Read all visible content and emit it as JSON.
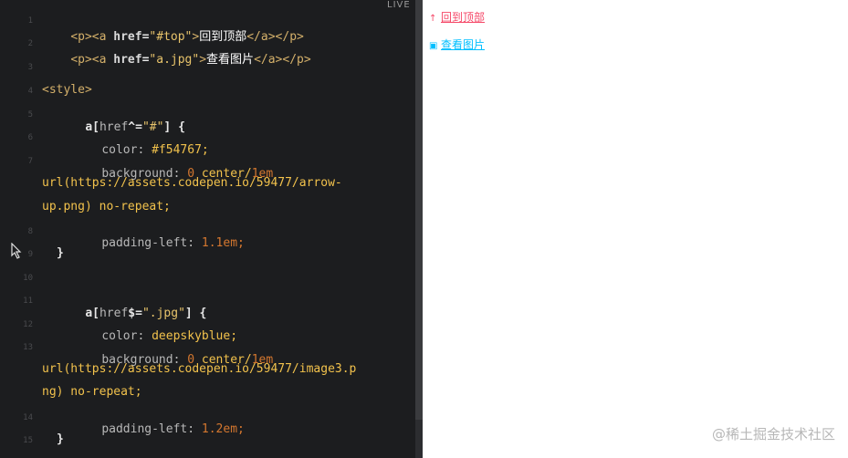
{
  "editor": {
    "gutter": [
      "1",
      "2",
      "3",
      "4",
      "5",
      "6",
      "7",
      "",
      "8",
      "9",
      "10",
      "11",
      "12",
      "13",
      "",
      "14",
      "15"
    ],
    "code": {
      "l1": {
        "p1": "<p><a ",
        "attr": "href",
        "eq": "=",
        "val": "\"#top\"",
        "close": ">",
        "text": "回到顶部",
        "end": "</a></p>"
      },
      "l2": {
        "p1": "<p><a ",
        "attr": "href",
        "eq": "=",
        "val": "\"a.jpg\"",
        "close": ">",
        "text": "查看图片",
        "end": "</a></p>"
      },
      "l4": "<style>",
      "l5": {
        "sel": "a",
        "open": "[",
        "attr": "href",
        "op": "^=",
        "val": "\"#\"",
        "rest": "] {"
      },
      "l6": {
        "prop": "color: ",
        "val": "#f54767;"
      },
      "l7": {
        "prop": "background: ",
        "zero": "0",
        "center": " center/",
        "em": "1em"
      },
      "l7b": "url(https://assets.codepen.io/59477/arrow-",
      "l7c": "up.png) no-repeat;",
      "l8": {
        "prop": "padding-left: ",
        "val": "1.1em;"
      },
      "l9": "}",
      "l11": {
        "sel": "a",
        "open": "[",
        "attr": "href",
        "op": "$=",
        "val": "\".jpg\"",
        "rest": "] {"
      },
      "l12": {
        "prop": "color: ",
        "val": "deepskyblue;"
      },
      "l13": {
        "prop": "background: ",
        "zero": "0",
        "center": " center/",
        "em": "1em"
      },
      "l13b": "url(https://assets.codepen.io/59477/image3.p",
      "l13c": "ng) no-repeat;",
      "l14": {
        "prop": "padding-left: ",
        "val": "1.2em;"
      },
      "l15": "}"
    }
  },
  "live_label": "LIVE",
  "preview": {
    "link1": {
      "text": "回到顶部",
      "color": "#f54767",
      "icon": "arrow-up-icon",
      "glyph": "↑"
    },
    "link2": {
      "text": "查看图片",
      "color": "#00bfff",
      "icon": "image-icon",
      "glyph": "▣"
    }
  },
  "watermark": "@稀土掘金技术社区"
}
